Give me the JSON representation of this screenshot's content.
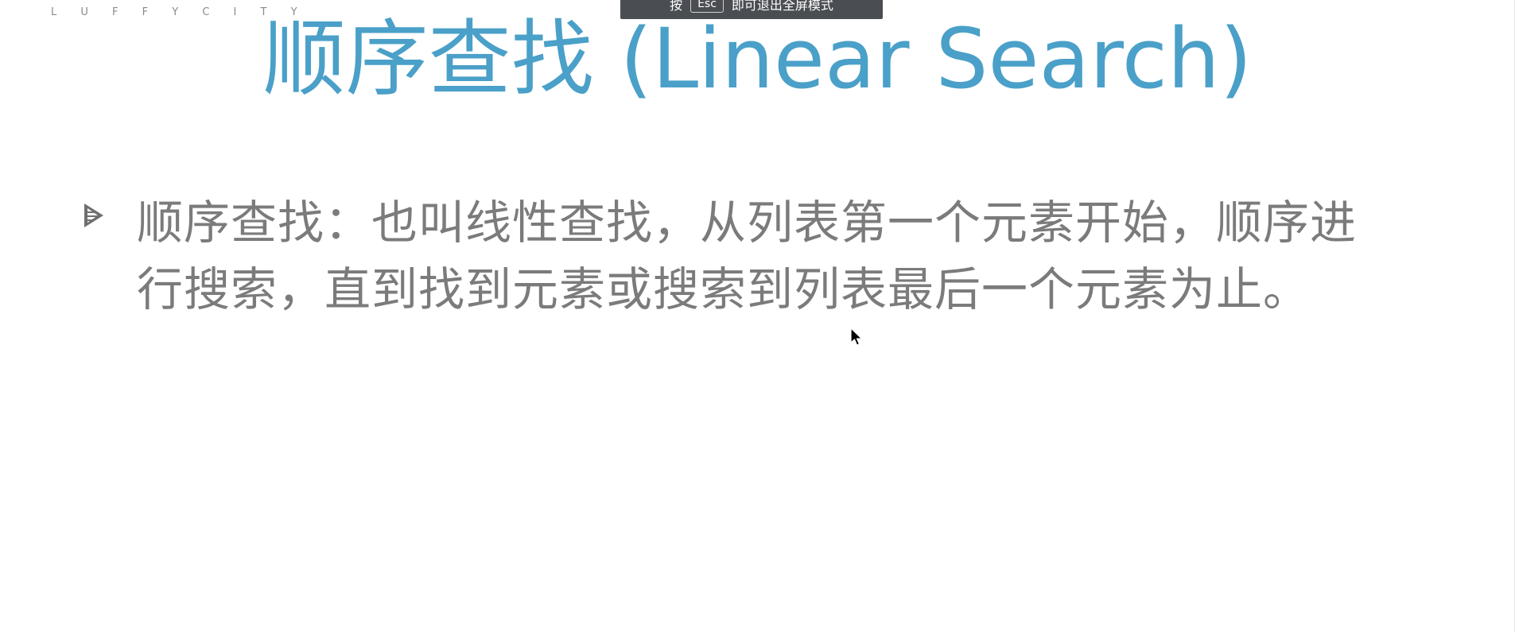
{
  "header": {
    "brand": "L U F F Y C I T Y"
  },
  "fullscreen_notice": {
    "prefix": "按",
    "key": "Esc",
    "suffix": "即可退出全屏模式"
  },
  "slide": {
    "title": "顺序查找 (Linear Search)",
    "bullets": [
      {
        "icon": "triangle-bullet-icon",
        "text": "顺序查找：也叫线性查找，从列表第一个元素开始，顺序进行搜索，直到找到元素或搜索到列表最后一个元素为止。"
      }
    ]
  },
  "colors": {
    "title": "#4aa0c8",
    "body_text": "#7b7b7b",
    "brand": "#8a8a8a",
    "toast_bg": "#4a4d52"
  },
  "icons": {
    "cursor": "mouse-pointer-icon"
  }
}
